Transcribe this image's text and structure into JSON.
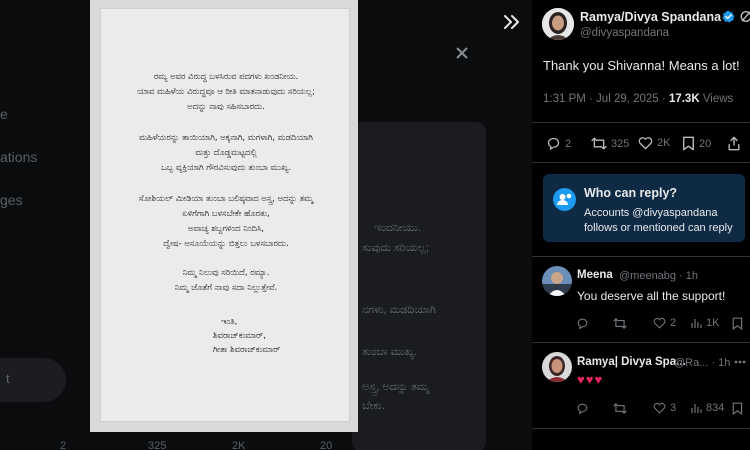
{
  "left_bg": {
    "nav_fragments": [
      "e",
      "ations",
      "ges"
    ],
    "pill_label": "t",
    "timeline_fragments": [
      "ಇಂದನೀಯು.",
      "ಸುವುದು ಸರಿಯಲ್ಲ;",
      "ನಗಳು, ಮಡದಿಯಾಗಿ",
      "ತುಂಬಾ ಮುಖ್ಯ.",
      "ಅಸ್ತ್ರ, ಅದನ್ನು ತಮ್ಮ",
      "ಬೇಕು."
    ],
    "bottom_counts": [
      "2",
      "325",
      "2K",
      "20"
    ]
  },
  "letter": {
    "lines": [
      "ರಮ್ಯ ಅವರ ವಿರುದ್ಧ ಬಳಸಿರುವ ಪದಗಳು ಖಂಡನೀಯ.",
      "ಯಾವ ಮಹಿಳೆಯ ವಿರುದ್ಧವೂ ಆ ರೀತಿ ಮಾತನಾಡುವುದು ಸರಿಯಲ್ಲ;",
      "ಅದನ್ನು ನಾವು ಸಹಿಸಬಾರದು.",
      "ಮಹಿಳೆಯರನ್ನು ತಾಯಿಯಾಗಿ, ಅಕ್ಕನಾಗಿ, ಮಗಳಾಗಿ, ಮಡದಿಯಾಗಿ",
      "ಮತ್ತು ದೊಡ್ಡಮಟ್ಟದಲ್ಲಿ",
      "ಒಬ್ಬ ವ್ಯಕ್ತಿಯಾಗಿ ಗೌರವಿಸುವುದು ತುಂಬಾ ಮುಖ್ಯ.",
      "ಸೋಶಿಯಲ್ ಮೀಡಿಯಾ ತುಂಬಾ ಬಲಿಷ್ಠವಾದ ಅಸ್ತ್ರ, ಅದನ್ನು ತಮ್ಮ",
      "ಏಳಿಗೆಗಾಗಿ ಬಳಸಬೇಕೇ ಹೊರತು,",
      "ಅವಾಚ್ಯ ಶಬ್ದಗಳಿಂದ ನಿಂದಿಸಿ,",
      "ದ್ವೇಷ- ಅಸೂಯೆಯನ್ನು ಬಿತ್ತಲು ಬಳಸಬಾರದು.",
      "ನಿಮ್ಮ ನಿಲುವು ಸರಿಯಿದೆ, ರಮ್ಯಾ.",
      "ನಿಮ್ಮ ಜೊತೆಗೆ ನಾವು ಸದಾ ನಿಲ್ಲುತ್ತೇವೆ."
    ],
    "sign_lines": [
      "ಇಂತಿ,",
      "ಶಿವರಾಜ್‌ಕುಮಾರ್,",
      "ಗೀತಾ ಶಿವರಾಜ್‌ಕುಮಾರ್"
    ]
  },
  "post": {
    "author_name": "Ramya/Divya Spandana",
    "author_handle": "@divyaspandana",
    "text": "Thank you Shivanna! Means a lot!",
    "time": "1:31 PM · Jul 29, 2025 ·",
    "views_count": "17.3K",
    "views_label": "Views",
    "replies": "2",
    "reposts": "325",
    "likes": "2K",
    "bookmarks": "20"
  },
  "who_can_reply": {
    "title": "Who can reply?",
    "description": "Accounts @divyaspandana follows or mentioned can reply"
  },
  "replies": [
    {
      "name": "Meena",
      "handle": "@meenabg · 1h",
      "text": "You deserve all the support!",
      "reposts": "",
      "likes": "2",
      "views": "1K"
    },
    {
      "name": "Ramya| Divya Spa...",
      "handle": "@Ra... · 1h",
      "text": "♥♥♥",
      "reposts": "",
      "likes": "3",
      "views": "834"
    }
  ],
  "colors": {
    "accent": "#1d9bf0",
    "reply_card_bg": "#0f2a44",
    "heart_red": "#e0245e"
  }
}
